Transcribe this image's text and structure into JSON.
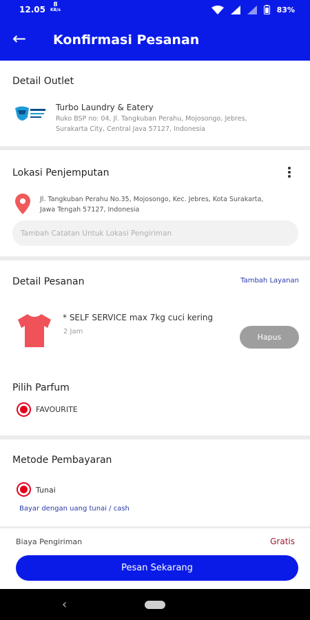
{
  "status": {
    "time": "12.05",
    "net_speed": "8",
    "net_unit": "KB/s",
    "battery": "83%"
  },
  "header": {
    "title": "Konfirmasi Pesanan"
  },
  "outlet": {
    "section_title": "Detail Outlet",
    "name": "Turbo Laundry & Eatery",
    "address": "Ruko BSP no: 04, Jl. Tangkuban Perahu, Mojosongo, Jebres, Surakarta City, Central Java 57127, Indonesia"
  },
  "pickup": {
    "section_title": "Lokasi Penjemputan",
    "address": "Jl. Tangkuban Perahu No.35, Mojosongo, Kec. Jebres, Kota Surakarta, Jawa Tengah 57127, Indonesia",
    "note_placeholder": "Tambah Catatan Untuk Lokasi Pengiriman"
  },
  "order": {
    "section_title": "Detail Pesanan",
    "add_service": "Tambah Layanan",
    "item_name": "* SELF SERVICE max 7kg cuci kering",
    "item_duration": "2 Jam",
    "remove_label": "Hapus"
  },
  "perfume": {
    "section_title": "Pilih Parfum",
    "selected": "FAVOURITE"
  },
  "payment": {
    "section_title": "Metode Pembayaran",
    "selected": "Tunai",
    "description": "Bayar dengan uang tunai / cash"
  },
  "shipping": {
    "label": "Biaya Pengiriman",
    "value": "Gratis"
  },
  "cta": {
    "label": "Pesan Sekarang"
  },
  "colors": {
    "primary": "#0a1be8",
    "radio": "#e2001a",
    "fee_value": "#9e1b32",
    "shirt": "#f0525a"
  }
}
